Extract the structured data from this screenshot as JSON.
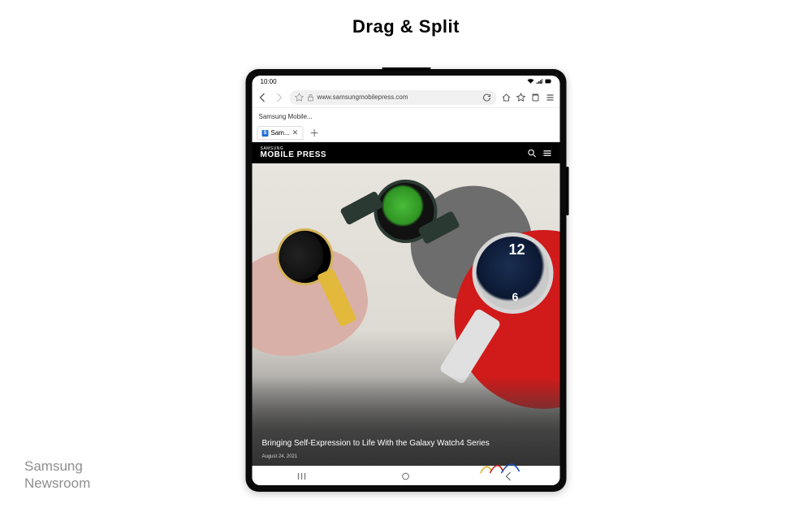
{
  "page_title": "Drag & Split",
  "watermark_line1": "Samsung",
  "watermark_line2": "Newsroom",
  "status": {
    "time": "10:00"
  },
  "browser": {
    "url": "www.samsungmobilepress.com",
    "bookmark_label": "Samsung Mobile...",
    "tab_label": "Sam...",
    "tab_favicon_letter": "S"
  },
  "site": {
    "brand_top": "SAMSUNG",
    "brand_main": "MOBILE PRESS"
  },
  "article": {
    "headline": "Bringing Self-Expression to Life With the Galaxy Watch4 Series",
    "date": "August 24, 2021",
    "watch_numerals": {
      "twelve": "12",
      "six": "6"
    }
  }
}
